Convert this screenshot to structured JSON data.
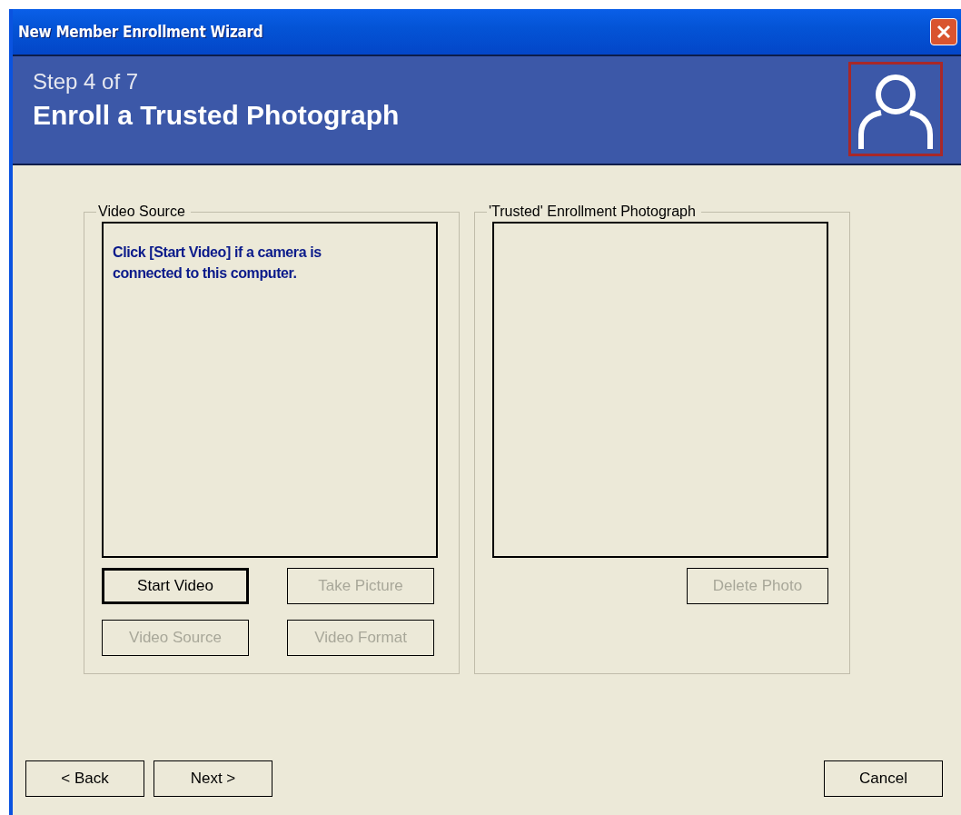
{
  "window": {
    "title": "New Member Enrollment Wizard"
  },
  "header": {
    "step": "Step 4 of 7",
    "title": "Enroll a Trusted Photograph"
  },
  "video_group": {
    "legend": "Video Source",
    "message": "Click [Start Video] if a camera is connected to this computer.",
    "buttons": [
      {
        "label": "Start Video",
        "disabled": false,
        "default": true
      },
      {
        "label": "Take Picture",
        "disabled": true,
        "default": false
      },
      {
        "label": "Video Source",
        "disabled": true,
        "default": false
      },
      {
        "label": "Video Format",
        "disabled": true,
        "default": false
      }
    ]
  },
  "photo_group": {
    "legend": "'Trusted' Enrollment Photograph",
    "buttons": [
      {
        "label": "Delete Photo",
        "disabled": true,
        "default": false
      }
    ]
  },
  "footer": {
    "buttons": [
      {
        "label": "< Back",
        "disabled": false,
        "default": false
      },
      {
        "label": "Next >",
        "disabled": false,
        "default": false
      },
      {
        "label": "Cancel",
        "disabled": false,
        "default": false
      }
    ]
  }
}
